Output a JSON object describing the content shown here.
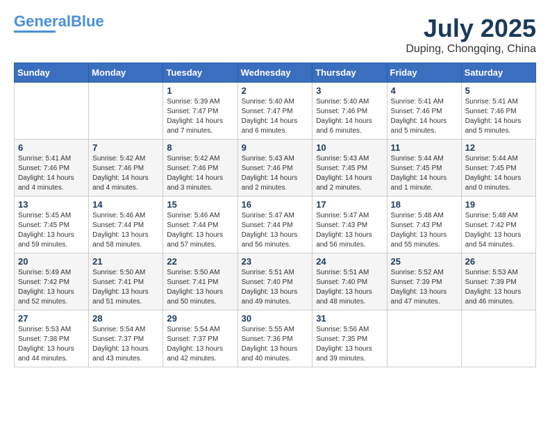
{
  "header": {
    "logo_line1": "General",
    "logo_line2": "Blue",
    "month_year": "July 2025",
    "location": "Duping, Chongqing, China"
  },
  "weekdays": [
    "Sunday",
    "Monday",
    "Tuesday",
    "Wednesday",
    "Thursday",
    "Friday",
    "Saturday"
  ],
  "weeks": [
    [
      {
        "day": "",
        "info": ""
      },
      {
        "day": "",
        "info": ""
      },
      {
        "day": "1",
        "info": "Sunrise: 5:39 AM\nSunset: 7:47 PM\nDaylight: 14 hours and 7 minutes."
      },
      {
        "day": "2",
        "info": "Sunrise: 5:40 AM\nSunset: 7:47 PM\nDaylight: 14 hours and 6 minutes."
      },
      {
        "day": "3",
        "info": "Sunrise: 5:40 AM\nSunset: 7:46 PM\nDaylight: 14 hours and 6 minutes."
      },
      {
        "day": "4",
        "info": "Sunrise: 5:41 AM\nSunset: 7:46 PM\nDaylight: 14 hours and 5 minutes."
      },
      {
        "day": "5",
        "info": "Sunrise: 5:41 AM\nSunset: 7:46 PM\nDaylight: 14 hours and 5 minutes."
      }
    ],
    [
      {
        "day": "6",
        "info": "Sunrise: 5:41 AM\nSunset: 7:46 PM\nDaylight: 14 hours and 4 minutes."
      },
      {
        "day": "7",
        "info": "Sunrise: 5:42 AM\nSunset: 7:46 PM\nDaylight: 14 hours and 4 minutes."
      },
      {
        "day": "8",
        "info": "Sunrise: 5:42 AM\nSunset: 7:46 PM\nDaylight: 14 hours and 3 minutes."
      },
      {
        "day": "9",
        "info": "Sunrise: 5:43 AM\nSunset: 7:46 PM\nDaylight: 14 hours and 2 minutes."
      },
      {
        "day": "10",
        "info": "Sunrise: 5:43 AM\nSunset: 7:45 PM\nDaylight: 14 hours and 2 minutes."
      },
      {
        "day": "11",
        "info": "Sunrise: 5:44 AM\nSunset: 7:45 PM\nDaylight: 14 hours and 1 minute."
      },
      {
        "day": "12",
        "info": "Sunrise: 5:44 AM\nSunset: 7:45 PM\nDaylight: 14 hours and 0 minutes."
      }
    ],
    [
      {
        "day": "13",
        "info": "Sunrise: 5:45 AM\nSunset: 7:45 PM\nDaylight: 13 hours and 59 minutes."
      },
      {
        "day": "14",
        "info": "Sunrise: 5:46 AM\nSunset: 7:44 PM\nDaylight: 13 hours and 58 minutes."
      },
      {
        "day": "15",
        "info": "Sunrise: 5:46 AM\nSunset: 7:44 PM\nDaylight: 13 hours and 57 minutes."
      },
      {
        "day": "16",
        "info": "Sunrise: 5:47 AM\nSunset: 7:44 PM\nDaylight: 13 hours and 56 minutes."
      },
      {
        "day": "17",
        "info": "Sunrise: 5:47 AM\nSunset: 7:43 PM\nDaylight: 13 hours and 56 minutes."
      },
      {
        "day": "18",
        "info": "Sunrise: 5:48 AM\nSunset: 7:43 PM\nDaylight: 13 hours and 55 minutes."
      },
      {
        "day": "19",
        "info": "Sunrise: 5:48 AM\nSunset: 7:42 PM\nDaylight: 13 hours and 54 minutes."
      }
    ],
    [
      {
        "day": "20",
        "info": "Sunrise: 5:49 AM\nSunset: 7:42 PM\nDaylight: 13 hours and 52 minutes."
      },
      {
        "day": "21",
        "info": "Sunrise: 5:50 AM\nSunset: 7:41 PM\nDaylight: 13 hours and 51 minutes."
      },
      {
        "day": "22",
        "info": "Sunrise: 5:50 AM\nSunset: 7:41 PM\nDaylight: 13 hours and 50 minutes."
      },
      {
        "day": "23",
        "info": "Sunrise: 5:51 AM\nSunset: 7:40 PM\nDaylight: 13 hours and 49 minutes."
      },
      {
        "day": "24",
        "info": "Sunrise: 5:51 AM\nSunset: 7:40 PM\nDaylight: 13 hours and 48 minutes."
      },
      {
        "day": "25",
        "info": "Sunrise: 5:52 AM\nSunset: 7:39 PM\nDaylight: 13 hours and 47 minutes."
      },
      {
        "day": "26",
        "info": "Sunrise: 5:53 AM\nSunset: 7:39 PM\nDaylight: 13 hours and 46 minutes."
      }
    ],
    [
      {
        "day": "27",
        "info": "Sunrise: 5:53 AM\nSunset: 7:38 PM\nDaylight: 13 hours and 44 minutes."
      },
      {
        "day": "28",
        "info": "Sunrise: 5:54 AM\nSunset: 7:37 PM\nDaylight: 13 hours and 43 minutes."
      },
      {
        "day": "29",
        "info": "Sunrise: 5:54 AM\nSunset: 7:37 PM\nDaylight: 13 hours and 42 minutes."
      },
      {
        "day": "30",
        "info": "Sunrise: 5:55 AM\nSunset: 7:36 PM\nDaylight: 13 hours and 40 minutes."
      },
      {
        "day": "31",
        "info": "Sunrise: 5:56 AM\nSunset: 7:35 PM\nDaylight: 13 hours and 39 minutes."
      },
      {
        "day": "",
        "info": ""
      },
      {
        "day": "",
        "info": ""
      }
    ]
  ]
}
